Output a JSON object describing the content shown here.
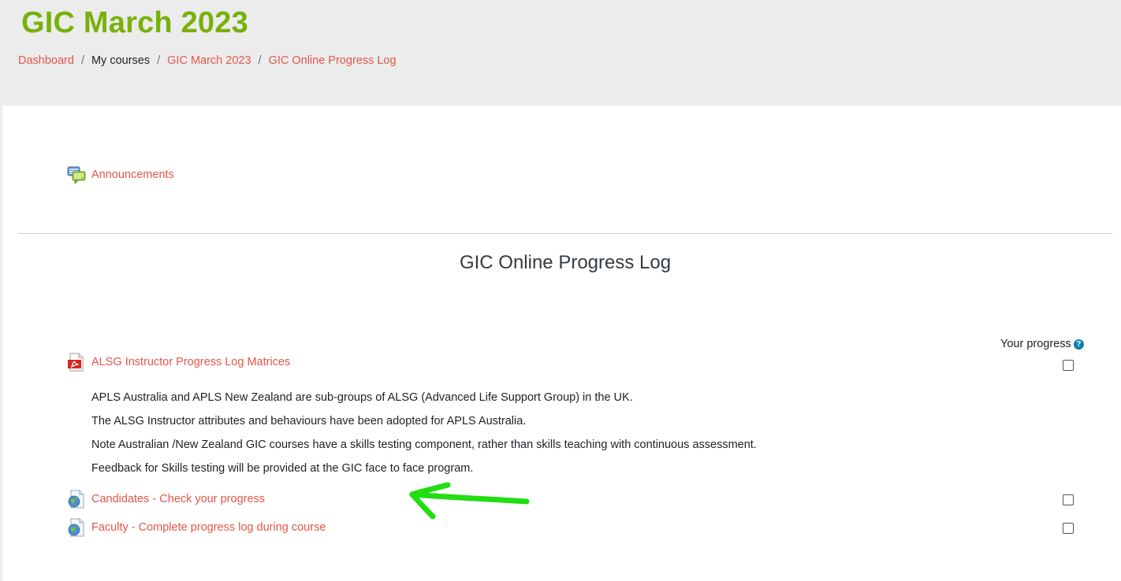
{
  "header": {
    "course_title": "GIC March 2023",
    "breadcrumb": [
      {
        "label": "Dashboard",
        "link": true
      },
      {
        "label": "My courses",
        "link": false
      },
      {
        "label": "GIC March 2023",
        "link": true
      },
      {
        "label": "GIC Online Progress Log",
        "link": true
      }
    ],
    "separator": "/"
  },
  "top_section": {
    "announcements": {
      "label": "Announcements",
      "icon": "forum-icon"
    }
  },
  "progress_section": {
    "title": "GIC Online Progress Log",
    "your_progress_label": "Your progress",
    "help_glyph": "?",
    "activities": [
      {
        "label": "ALSG Instructor Progress Log Matrices",
        "icon": "pdf-file-icon",
        "completed": false,
        "description": [
          "APLS Australia and APLS New Zealand are sub-groups of ALSG (Advanced Life Support Group) in the UK.",
          "The ALSG Instructor attributes and behaviours have been adopted for APLS Australia.",
          "Note Australian /New Zealand GIC courses have a skills testing component, rather than skills teaching with continuous assessment.",
          "Feedback for Skills testing will be provided at the GIC face to face program."
        ]
      },
      {
        "label": "Candidates - Check your progress",
        "icon": "url-globe-icon",
        "completed": false
      },
      {
        "label": "Faculty - Complete progress log during course",
        "icon": "url-globe-icon",
        "completed": false
      }
    ]
  },
  "colors": {
    "accent_green": "#78b10a",
    "link_red": "#e2574a",
    "annotation_green": "#22dd11",
    "help_blue": "#0f7fa8"
  }
}
